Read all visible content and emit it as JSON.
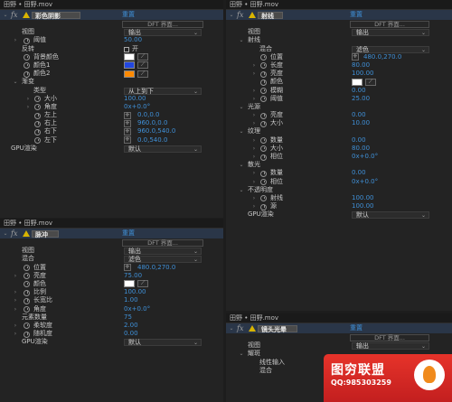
{
  "colors": {
    "value": "#3f8fd6",
    "blue": "#2247e0",
    "orange": "#ff8a00",
    "white": "#ffffff"
  },
  "icons": {
    "stopwatch": "stopwatch-icon",
    "warning": "warning-icon",
    "eyedropper": "eyedropper-icon",
    "crosshair": "crosshair-icon"
  },
  "p1": {
    "header": "田野 • 田野.mov",
    "fx": "fx",
    "effect": "彩色阴影",
    "reset": "重置",
    "dft": "DFT 界面...",
    "rows": [
      {
        "lbl": "视图",
        "dd": "输出"
      },
      {
        "lbl": "阈值",
        "val": "50.00"
      },
      {
        "lbl": "反转",
        "chk": "开"
      },
      {
        "lbl": "背景颜色"
      },
      {
        "lbl": "颜色1"
      },
      {
        "lbl": "颜色2"
      },
      {
        "lbl": "渐变"
      },
      {
        "lbl": "类型",
        "dd": "从上到下"
      },
      {
        "lbl": "大小",
        "val": "100.00"
      },
      {
        "lbl": "角度",
        "val": "0x+0.0°"
      },
      {
        "lbl": "左上",
        "val": "0.0,0.0"
      },
      {
        "lbl": "右上",
        "val": "960.0,0.0"
      },
      {
        "lbl": "右下",
        "val": "960.0,540.0"
      },
      {
        "lbl": "左下",
        "val": "0.0,540.0"
      },
      {
        "lbl": "GPU渲染",
        "dd": "默认"
      }
    ]
  },
  "p2": {
    "header": "田野 • 田野.mov",
    "fx": "fx",
    "effect": "脉冲",
    "reset": "重置",
    "dft": "DFT 界面...",
    "rows": [
      {
        "lbl": "视图",
        "dd": "输出"
      },
      {
        "lbl": "混合",
        "dd": "滤色"
      },
      {
        "lbl": "位置",
        "val": "480.0,270.0"
      },
      {
        "lbl": "亮度",
        "val": "75.00"
      },
      {
        "lbl": "颜色"
      },
      {
        "lbl": "比例",
        "val": "100.00"
      },
      {
        "lbl": "长宽比",
        "val": "1.00"
      },
      {
        "lbl": "角度",
        "val": "0x+0.0°"
      },
      {
        "lbl": "元素数量",
        "val": "75"
      },
      {
        "lbl": "柔软度",
        "val": "2.00"
      },
      {
        "lbl": "随机度",
        "val": "0.00"
      },
      {
        "lbl": "GPU渲染",
        "dd": "默认"
      }
    ]
  },
  "p3": {
    "header": "田野 • 田野.mov",
    "fx": "fx",
    "effect": "射线",
    "reset": "重置",
    "dft": "DFT 界面...",
    "rows": [
      {
        "lbl": "视图",
        "dd": "输出"
      },
      {
        "lbl": "射线"
      },
      {
        "lbl": "混合",
        "dd": "滤色"
      },
      {
        "lbl": "位置",
        "val": "480.0,270.0"
      },
      {
        "lbl": "长度",
        "val": "80.00"
      },
      {
        "lbl": "亮度",
        "val": "100.00"
      },
      {
        "lbl": "颜色"
      },
      {
        "lbl": "模糊",
        "val": "0.00"
      },
      {
        "lbl": "阈值",
        "val": "25.00"
      },
      {
        "lbl": "光源"
      },
      {
        "lbl": "亮度",
        "val": "0.00"
      },
      {
        "lbl": "大小",
        "val": "10.00"
      },
      {
        "lbl": "纹理"
      },
      {
        "lbl": "数量",
        "val": "0.00"
      },
      {
        "lbl": "大小",
        "val": "80.00"
      },
      {
        "lbl": "相位",
        "val": "0x+0.0°"
      },
      {
        "lbl": "散光"
      },
      {
        "lbl": "数量",
        "val": "0.00"
      },
      {
        "lbl": "相位",
        "val": "0x+0.0°"
      },
      {
        "lbl": "不透明度"
      },
      {
        "lbl": "射线",
        "val": "100.00"
      },
      {
        "lbl": "源",
        "val": "100.00"
      },
      {
        "lbl": "GPU渲染",
        "dd": "默认"
      }
    ]
  },
  "p4": {
    "header": "田野 • 田野.mov",
    "fx": "fx",
    "effect": "镜头光晕",
    "reset": "重置",
    "dft": "DFT 界面...",
    "rows": [
      {
        "lbl": "视图",
        "dd": "输出"
      },
      {
        "lbl": "耀斑"
      },
      {
        "lbl": "线性输入"
      },
      {
        "lbl": "混合"
      }
    ]
  },
  "watermark": {
    "title": "图穷联盟",
    "qq": "QQ:985303259"
  }
}
